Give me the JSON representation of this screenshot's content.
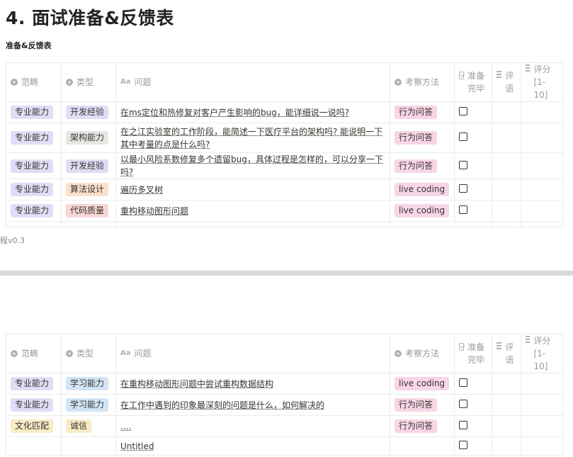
{
  "page": {
    "title": "4. 面试准备&反馈表",
    "subtitle": "准备&反馈表",
    "version_text": "程v0.3"
  },
  "columns": {
    "category": "范畴",
    "type": "类型",
    "question": "问题",
    "method": "考察方法",
    "prepared": "准备完毕",
    "comment": "评语",
    "score": "评分[1-10]"
  },
  "table1": {
    "rows": [
      {
        "category": "专业能力",
        "category_color": "purple",
        "type": "开发经验",
        "type_color": "purple",
        "question": "在ms定位和热修复对客户产生影响的bug，能详细说一说吗?",
        "method": "行为问答",
        "method_color": "pink",
        "prepared": false,
        "comment": "",
        "score": ""
      },
      {
        "category": "专业能力",
        "category_color": "purple",
        "type": "架构能力",
        "type_color": "gray",
        "question": "在之江实验室的工作阶段，能简述一下医疗平台的架构吗? 能说明一下其中考量的点是什么吗?",
        "method": "行为问答",
        "method_color": "pink",
        "prepared": false,
        "comment": "",
        "score": ""
      },
      {
        "category": "专业能力",
        "category_color": "purple",
        "type": "开发经验",
        "type_color": "purple",
        "question": "以最小风险系数修复多个遗留bug，具体过程是怎样的，可以分享一下吗?",
        "method": "行为问答",
        "method_color": "pink",
        "prepared": false,
        "comment": "",
        "score": ""
      },
      {
        "category": "专业能力",
        "category_color": "purple",
        "type": "算法设计",
        "type_color": "orange",
        "question": "遍历多叉树",
        "method": "live coding",
        "method_color": "pink",
        "prepared": false,
        "comment": "",
        "score": ""
      },
      {
        "category": "专业能力",
        "category_color": "purple",
        "type": "代码质量",
        "type_color": "red",
        "question": "重构移动图形问题",
        "method": "live coding",
        "method_color": "pink",
        "prepared": false,
        "comment": "",
        "score": ""
      }
    ]
  },
  "table2": {
    "rows": [
      {
        "category": "专业能力",
        "category_color": "purple",
        "type": "学习能力",
        "type_color": "blue",
        "question": "在重构移动图形问题中尝试重构数据结构",
        "method": "live coding",
        "method_color": "pink",
        "prepared": false,
        "comment": "",
        "score": ""
      },
      {
        "category": "专业能力",
        "category_color": "purple",
        "type": "学习能力",
        "type_color": "blue",
        "question": "在工作中遇到的印象最深刻的问题是什么，如何解决的",
        "method": "行为问答",
        "method_color": "pink",
        "prepared": false,
        "comment": "",
        "score": ""
      },
      {
        "category": "文化匹配",
        "category_color": "yellow",
        "type": "诚信",
        "type_color": "yellow",
        "question": "....",
        "method": "行为问答",
        "method_color": "pink",
        "prepared": false,
        "comment": "",
        "score": ""
      },
      {
        "category": "",
        "category_color": "",
        "type": "",
        "type_color": "",
        "question": "Untitled",
        "method": "",
        "method_color": "",
        "prepared": false,
        "comment": "",
        "score": ""
      }
    ]
  },
  "icons": {
    "select": "select-icon",
    "text": "text-icon",
    "checkbox": "checkbox-icon",
    "rich_text": "rich-text-icon"
  }
}
